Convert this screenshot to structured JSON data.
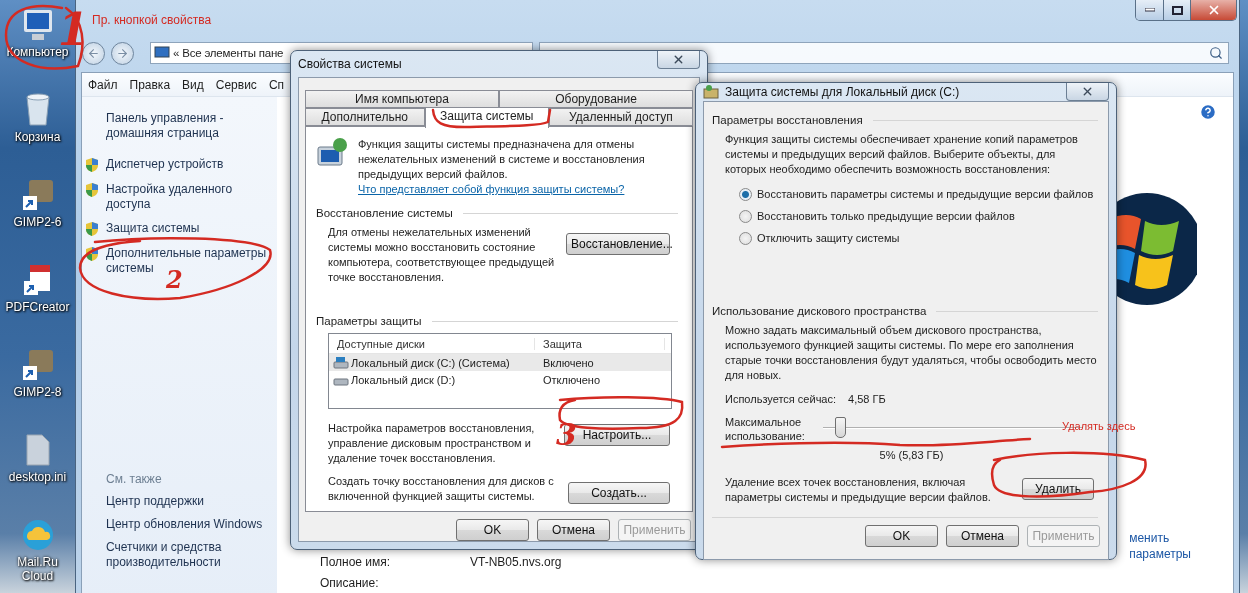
{
  "desktop_icons": [
    {
      "label": "Компьютер"
    },
    {
      "label": "Корзина"
    },
    {
      "label": "GIMP2-6"
    },
    {
      "label": "PDFCreator"
    },
    {
      "label": "GIMP2-8"
    },
    {
      "label": "desktop.ini"
    },
    {
      "label": "Mail.Ru Cloud"
    }
  ],
  "explorer": {
    "address_prefix": "«",
    "address": "Все элементы пане",
    "menu": [
      "Файл",
      "Правка",
      "Вид",
      "Сервис",
      "Сп"
    ],
    "nav_links": [
      {
        "kind": "plain",
        "label": "Панель управления - домашняя страница"
      },
      {
        "kind": "shield",
        "label": "Диспетчер устройств"
      },
      {
        "kind": "shield",
        "label": "Настройка удаленного доступа"
      },
      {
        "kind": "shield",
        "label": "Защита системы"
      },
      {
        "kind": "shield",
        "label": "Дополнительные параметры системы"
      }
    ],
    "see_also_title": "См. также",
    "see_also": [
      "Центр поддержки",
      "Центр обновления Windows",
      "Счетчики и средства производительности"
    ],
    "side_links": [
      "менить",
      "параметры"
    ],
    "fields": [
      {
        "label": "Полное имя:",
        "value": "VT-NB05.nvs.org"
      },
      {
        "label": "Описание:"
      }
    ]
  },
  "system_properties": {
    "title": "Свойства системы",
    "tab_rows": [
      [
        {
          "label": "Имя компьютера",
          "selected": false
        },
        {
          "label": "Оборудование",
          "selected": false
        }
      ],
      [
        {
          "label": "Дополнительно",
          "selected": false
        },
        {
          "label": "Защита системы",
          "selected": true
        },
        {
          "label": "Удаленный доступ",
          "selected": false
        }
      ]
    ],
    "intro": "Функция защиты системы предназначена для отмены нежелательных изменений в системе и восстановления предыдущих версий файлов.",
    "intro_link": "Что представляет собой функция защиты системы?",
    "restore": {
      "title": "Восстановление системы",
      "text": "Для отмены нежелательных изменений системы можно восстановить состояние компьютера, соответствующее предыдущей точке восстановления.",
      "button": "Восстановление..."
    },
    "protection": {
      "title": "Параметры защиты",
      "columns": [
        "Доступные диски",
        "Защита"
      ],
      "rows": [
        {
          "kind": "system",
          "name": "Локальный диск (C:) (Система)",
          "status": "Включено",
          "selected": true
        },
        {
          "kind": "drive",
          "name": "Локальный диск (D:)",
          "status": "Отключено",
          "selected": false
        }
      ],
      "configure_text": "Настройка параметров восстановления, управление дисковым пространством и удаление точек восстановления.",
      "configure_button": "Настроить...",
      "create_text": "Создать точку восстановления для дисков с включенной функцией защиты системы.",
      "create_button": "Создать..."
    },
    "buttons": [
      {
        "label": "OK",
        "disabled": false
      },
      {
        "label": "Отмена",
        "disabled": false
      },
      {
        "label": "Применить",
        "disabled": true
      }
    ]
  },
  "disk_protection": {
    "title": "Защита системы для Локальный диск (C:)",
    "restore": {
      "title": "Параметры восстановления",
      "text": "Функция защиты системы обеспечивает хранение копий параметров системы и предыдущих версий файлов. Выберите объекты, для которых необходимо обеспечить возможность восстановления:",
      "options": [
        {
          "label": "Восстановить параметры системы и предыдущие версии файлов",
          "selected": true
        },
        {
          "label": "Восстановить только предыдущие версии файлов",
          "selected": false
        },
        {
          "label": "Отключить защиту системы",
          "selected": false
        }
      ]
    },
    "usage": {
      "title": "Использование дискового пространства",
      "text": "Можно задать максимальный объем дискового пространства, используемого функцией защиты системы. По мере его заполнения старые точки восстановления будут удаляться, чтобы освободить место для новых.",
      "current_label": "Используется сейчас:",
      "current_value": "4,58 ГБ",
      "max_label": "Максимальное использование:",
      "level": 0.05,
      "reading": "5% (5,83 ГБ)"
    },
    "delete_text": "Удаление всех точек восстановления, включая параметры системы и предыдущие версии файлов.",
    "delete_button": "Удалить",
    "buttons": [
      {
        "label": "OK",
        "disabled": false
      },
      {
        "label": "Отмена",
        "disabled": false
      },
      {
        "label": "Применить",
        "disabled": true
      }
    ]
  },
  "annotations": [
    {
      "kind": "number",
      "text": "1"
    },
    {
      "kind": "label",
      "text": "Пр. кнопкой свойства"
    },
    {
      "kind": "number",
      "text": "2"
    },
    {
      "kind": "number",
      "text": "3"
    },
    {
      "kind": "label",
      "text": "Удалять здесь"
    }
  ]
}
